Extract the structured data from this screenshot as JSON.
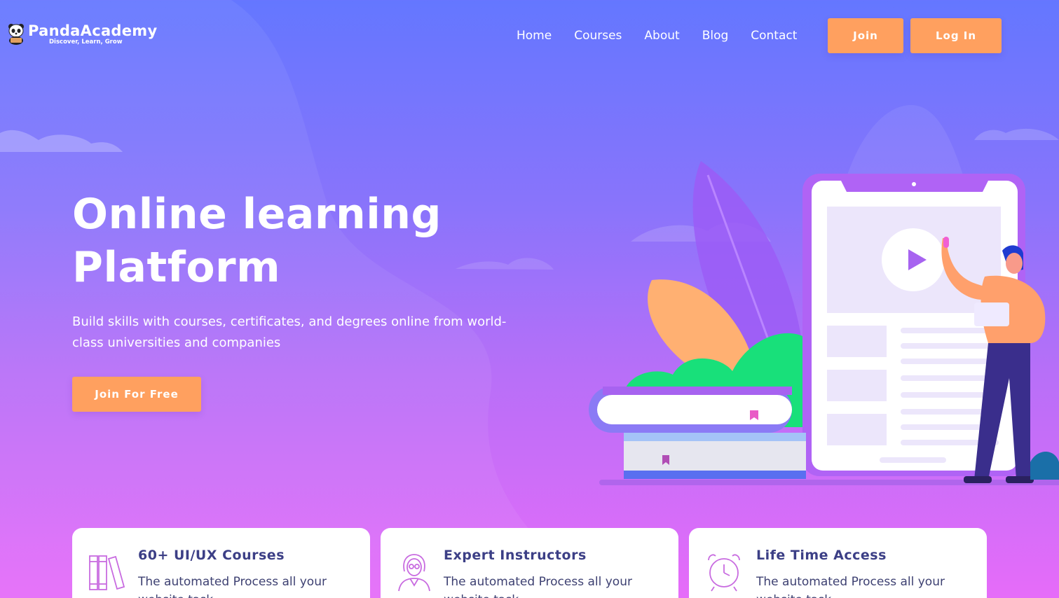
{
  "brand": {
    "name": "PandaAcademy",
    "tagline": "Discover, Learn, Grow"
  },
  "nav": {
    "items": [
      "Home",
      "Courses",
      "About",
      "Blog",
      "Contact"
    ]
  },
  "header_buttons": {
    "join": "Join",
    "login": "Log In"
  },
  "hero": {
    "title_line1": "Online learning",
    "title_line2": "Platform",
    "subtitle": "Build skills with courses, certificates, and degrees online from world-class universities and companies",
    "cta": "Join For Free"
  },
  "features": [
    {
      "title": "60+ UI/UX Courses",
      "desc": "The automated Process all your website task",
      "icon": "books-icon"
    },
    {
      "title": "Expert Instructors",
      "desc": "The automated Process all your website task",
      "icon": "instructor-icon"
    },
    {
      "title": "Life Time Access",
      "desc": "The automated Process all your website task",
      "icon": "alarm-clock-icon"
    }
  ],
  "colors": {
    "accent": "#ffa05f",
    "card_title": "#3c3f86",
    "gradient_top": "#6477ff",
    "gradient_bottom": "#e66cf9"
  }
}
